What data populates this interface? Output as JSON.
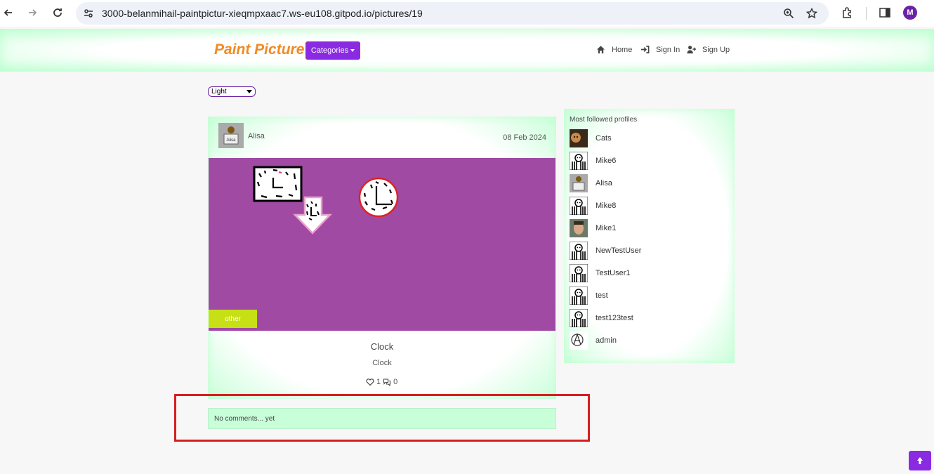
{
  "browser": {
    "url": "3000-belanmihail-paintpictur-xieqmpxaac7.ws-eu108.gitpod.io/pictures/19",
    "profile_initial": "M",
    "icons": [
      "back-icon",
      "forward-icon",
      "reload-icon",
      "site-info-icon",
      "zoom-icon",
      "bookmark-star-icon",
      "extensions-icon",
      "side-panel-icon"
    ]
  },
  "header": {
    "brand": "Paint Picture",
    "categories_label": "Categories",
    "nav": [
      {
        "label": "Home",
        "icon": "home-icon"
      },
      {
        "label": "Sign In",
        "icon": "sign-in-icon"
      },
      {
        "label": "Sign Up",
        "icon": "user-plus-icon"
      }
    ]
  },
  "theme": {
    "selected": "Light"
  },
  "post": {
    "author": "Alisa",
    "date": "08 Feb 2024",
    "category_tag": "other",
    "title": "Clock",
    "description": "Clock",
    "likes": "1",
    "comments": "0"
  },
  "comments": {
    "empty_text": "No comments... yet"
  },
  "sidebar": {
    "title": "Most followed profiles",
    "profiles": [
      {
        "name": "Cats",
        "avatar": "cat"
      },
      {
        "name": "Mike6",
        "avatar": "default"
      },
      {
        "name": "Alisa",
        "avatar": "alisa"
      },
      {
        "name": "Mike8",
        "avatar": "default"
      },
      {
        "name": "Mike1",
        "avatar": "photo"
      },
      {
        "name": "NewTestUser",
        "avatar": "default"
      },
      {
        "name": "TestUser1",
        "avatar": "default"
      },
      {
        "name": "test",
        "avatar": "default"
      },
      {
        "name": "test123test",
        "avatar": "default"
      },
      {
        "name": "admin",
        "avatar": "anarchy"
      }
    ]
  },
  "colors": {
    "accent": "#8a2be2",
    "brand": "#f08a24",
    "tag": "#c7e016",
    "picture_bg": "#a04aa4",
    "highlight": "#d81e1e",
    "panel_green": "#c8ffd8"
  }
}
